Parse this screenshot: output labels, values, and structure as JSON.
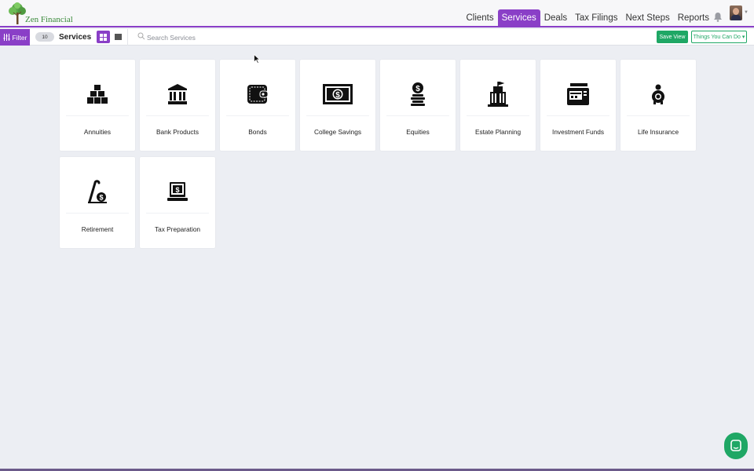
{
  "app": {
    "brand": "Zen Financial",
    "accent_color": "#8a3fc7",
    "success_color": "#1fa765"
  },
  "nav": {
    "items": [
      {
        "label": "Clients",
        "active": false
      },
      {
        "label": "Services",
        "active": true
      },
      {
        "label": "Deals",
        "active": false
      },
      {
        "label": "Tax Filings",
        "active": false
      },
      {
        "label": "Next Steps",
        "active": false
      },
      {
        "label": "Reports",
        "active": false
      }
    ],
    "icons": [
      "bell-icon",
      "avatar",
      "chevron-down-icon"
    ]
  },
  "toolbar": {
    "filter_label": "Filter",
    "count": "10",
    "title": "Services",
    "search_placeholder": "Search Services",
    "save_view_label": "Save View",
    "things_label": "Things You Can Do ▾"
  },
  "services": [
    {
      "label": "Annuities",
      "icon": "gold-bars-icon"
    },
    {
      "label": "Bank Products",
      "icon": "bank-icon"
    },
    {
      "label": "Bonds",
      "icon": "wallet-icon"
    },
    {
      "label": "College Savings",
      "icon": "banknote-icon"
    },
    {
      "label": "Equities",
      "icon": "coin-stack-icon"
    },
    {
      "label": "Estate Planning",
      "icon": "building-icon"
    },
    {
      "label": "Investment Funds",
      "icon": "card-reader-icon"
    },
    {
      "label": "Life Insurance",
      "icon": "piggy-bank-icon"
    },
    {
      "label": "Retirement",
      "icon": "cane-coin-icon"
    },
    {
      "label": "Tax Preparation",
      "icon": "laptop-dollar-icon"
    }
  ]
}
